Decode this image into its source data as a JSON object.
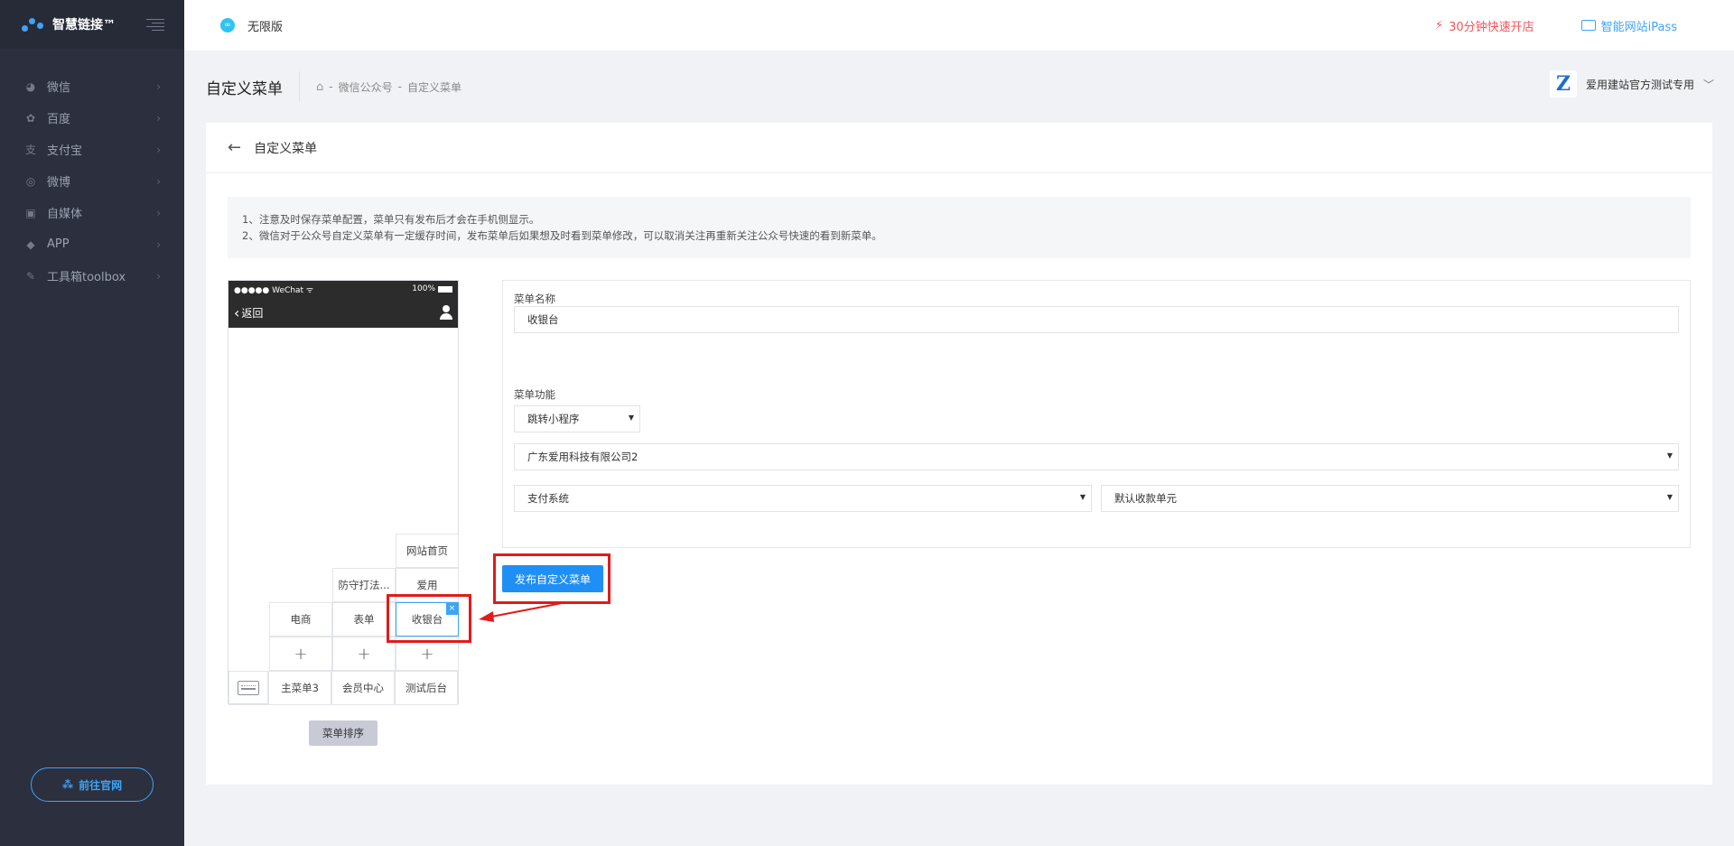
{
  "sidebar": {
    "brand": "智慧链接™",
    "items": [
      {
        "label": "微信",
        "icon": "wechat-icon"
      },
      {
        "label": "百度",
        "icon": "paw-icon"
      },
      {
        "label": "支付宝",
        "icon": "alipay-icon"
      },
      {
        "label": "微博",
        "icon": "weibo-icon"
      },
      {
        "label": "自媒体",
        "icon": "media-icon"
      },
      {
        "label": "APP",
        "icon": "android-icon"
      },
      {
        "label": "工具箱toolbox",
        "icon": "wrench-icon"
      }
    ],
    "goto_label": "前往官网"
  },
  "topbar": {
    "edition": "无限版",
    "quick_open": "30分钟快速开店",
    "ipass": "智能网站iPass"
  },
  "header": {
    "title": "自定义菜单",
    "breadcrumb": [
      "微信公众号",
      "自定义菜单"
    ],
    "account_name": "爱用建站官方测试专用",
    "account_logo_char": "Z"
  },
  "card": {
    "title": "自定义菜单",
    "notice": [
      "1、注意及时保存菜单配置，菜单只有发布后才会在手机侧显示。",
      "2、微信对于公众号自定义菜单有一定缓存时间，发布菜单后如果想及时看到菜单修改，可以取消关注再重新关注公众号快速的看到新菜单。"
    ]
  },
  "phone": {
    "status_left": "●●●●● WeChat ᯤ",
    "status_right": "100%",
    "back_label": "返回",
    "submenus": {
      "col3_top": "网站首页",
      "col2_mid": "防守打法...",
      "col3_mid": "爱用",
      "col1_low": "电商",
      "col2_low": "表单",
      "col3_low": "收银台"
    },
    "plus": "+",
    "main_menus": [
      "主菜单3",
      "会员中心",
      "测试后台"
    ],
    "selected_close": "×",
    "sort_label": "菜单排序"
  },
  "form": {
    "name_label": "菜单名称",
    "name_value": "收银台",
    "func_label": "菜单功能",
    "func_value": "跳转小程序",
    "program_value": "广东爱用科技有限公司2",
    "system_value": "支付系统",
    "unit_value": "默认收款单元",
    "publish_label": "发布自定义菜单"
  },
  "colors": {
    "accent": "#1f8ff5",
    "annotation": "#e01b1b",
    "sidebar_bg": "#2b2f3e"
  }
}
